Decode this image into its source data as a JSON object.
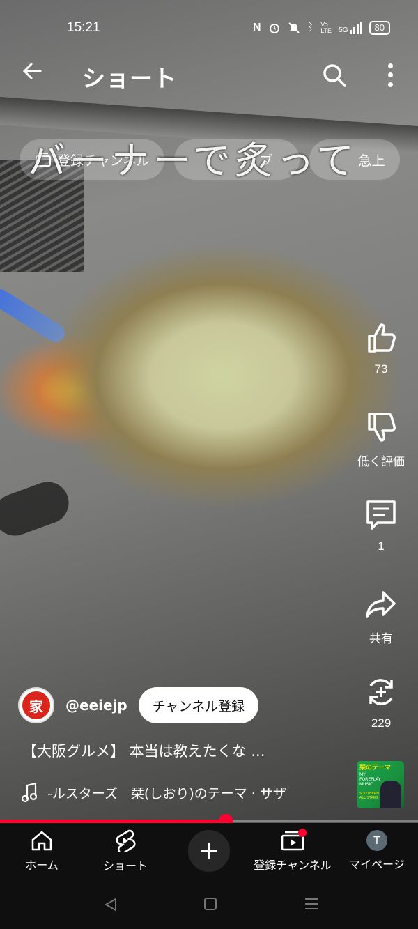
{
  "status_bar": {
    "time": "15:21",
    "battery": "80",
    "signal_icons": [
      "nfc-icon",
      "alarm-icon",
      "mute-icon",
      "bluetooth-icon",
      "volte-icon",
      "5g-signal-icon"
    ],
    "volte": "Vo LTE",
    "network": "5G"
  },
  "header": {
    "title": "ショート"
  },
  "chips": [
    {
      "label": "登録チャンネル",
      "icon": "subscriptions-icon"
    },
    {
      "label": "ブ",
      "icon": ""
    },
    {
      "label": "急上",
      "icon": ""
    }
  ],
  "video_overlay_text": "バーナーで炙って",
  "actions": {
    "like_count": "73",
    "dislike_label": "低く評価",
    "comment_count": "1",
    "share_label": "共有",
    "remix_count": "229"
  },
  "channel": {
    "handle": "@eeiejp",
    "avatar_char": "家",
    "subscribe_label": "チャンネル登録"
  },
  "video": {
    "title": "【大阪グルメ】 本当は教えたくな ..."
  },
  "music": {
    "text": "-ルスターズ　栞(しおり)のテーマ · サザ"
  },
  "sound_thumb": {
    "line1": "栞のテーマ",
    "line2": "MY FOREPLAY MUSIC",
    "line3": "SOUTHERN ALL STARS"
  },
  "progress": {
    "played_fraction": 0.54
  },
  "bottom_nav": {
    "home": "ホーム",
    "shorts": "ショート",
    "subscriptions": "登録チャンネル",
    "you": "マイページ",
    "you_avatar": "T"
  },
  "colors": {
    "accent": "#ff0033",
    "nav_bg": "#0f0f0f"
  }
}
